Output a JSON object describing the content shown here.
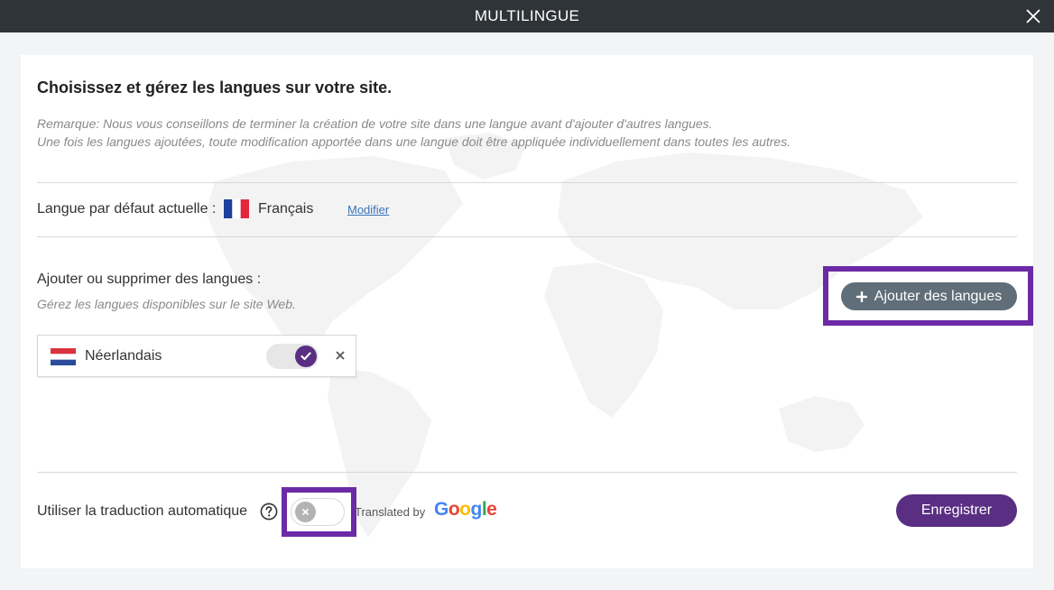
{
  "window": {
    "title": "MULTILINGUE",
    "close_icon": "close-icon"
  },
  "intro": {
    "heading": "Choisissez et gérez les langues sur votre site.",
    "note_line1": "Remarque: Nous vous conseillons de terminer la création de votre site dans une langue avant d'ajouter d'autres langues.",
    "note_line2": "Une fois les langues ajoutées, toute modification apportée dans une langue doit être appliquée individuellement dans toutes les autres."
  },
  "default_language": {
    "label": "Langue par défaut actuelle :",
    "name": "Français",
    "flag": "flag-france-icon",
    "modify_link": "Modifier"
  },
  "languages": {
    "label": "Ajouter ou supprimer des langues :",
    "sublabel": "Gérez les langues disponibles sur le site Web.",
    "add_button": "Ajouter des langues",
    "items": [
      {
        "name": "Néerlandais",
        "flag": "flag-netherlands-icon",
        "enabled": true
      }
    ]
  },
  "auto_translation": {
    "label": "Utiliser la traduction automatique",
    "enabled": false,
    "translated_by": "Translated by",
    "provider": "Google"
  },
  "footer": {
    "save_button": "Enregistrer"
  },
  "colors": {
    "titlebar": "#2f3438",
    "accent_purple": "#5a2e83",
    "highlight_purple": "#6c2aa6",
    "add_button_gray": "#5f6e78",
    "link_blue": "#3a74b8"
  }
}
